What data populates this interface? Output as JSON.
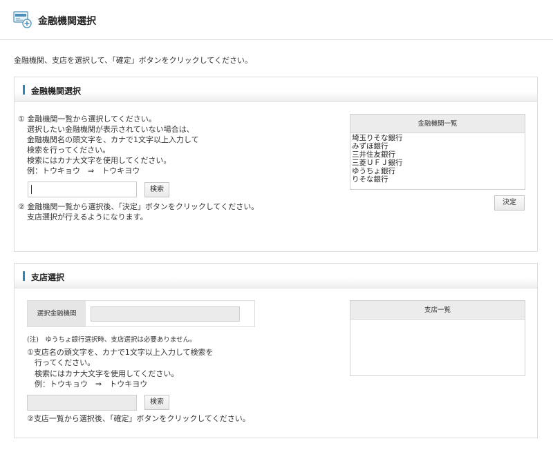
{
  "header": {
    "title": "金融機関選択",
    "icon": "bank-icon"
  },
  "intro": "金融機関、支店を選択して、「確定」ボタンをクリックしてください。",
  "bank_panel": {
    "title": "金融機関選択",
    "step1_lines": [
      "① 金融機関一覧から選択してください。",
      "選択したい金融機関が表示されていない場合は、",
      "金融機関名の頭文字を、カナで1文字以上入力して",
      "検索を行ってください。",
      "検索にはカナ大文字を使用してください。",
      "例：トウキョウ　⇒　トウキヨウ"
    ],
    "search_value": "",
    "search_button": "検索",
    "step2_lines": [
      "② 金融機関一覧から選択後、「決定」ボタンをクリックしてください。",
      "支店選択が行えるようになります。"
    ],
    "list_title": "金融機関一覧",
    "list_items": [
      "埼玉りそな銀行",
      "みずほ銀行",
      "三井住友銀行",
      "三菱ＵＦＪ銀行",
      "ゆうちょ銀行",
      "りそな銀行"
    ],
    "decide_button": "決定"
  },
  "branch_panel": {
    "title": "支店選択",
    "selected_label": "選択金融機関",
    "selected_value": "",
    "note": "(注)　ゆうちょ銀行選択時、支店選択は必要ありません。",
    "step1_lines": [
      "①支店名の頭文字を、カナで1文字以上入力して検索を",
      "行ってください。",
      "検索にはカナ大文字を使用してください。",
      "例：トウキョウ　⇒　トウキヨウ"
    ],
    "search_value": "",
    "search_button": "検索",
    "step2": "②支店一覧から選択後、「確定」ボタンをクリックしてください。",
    "list_title": "支店一覧"
  }
}
